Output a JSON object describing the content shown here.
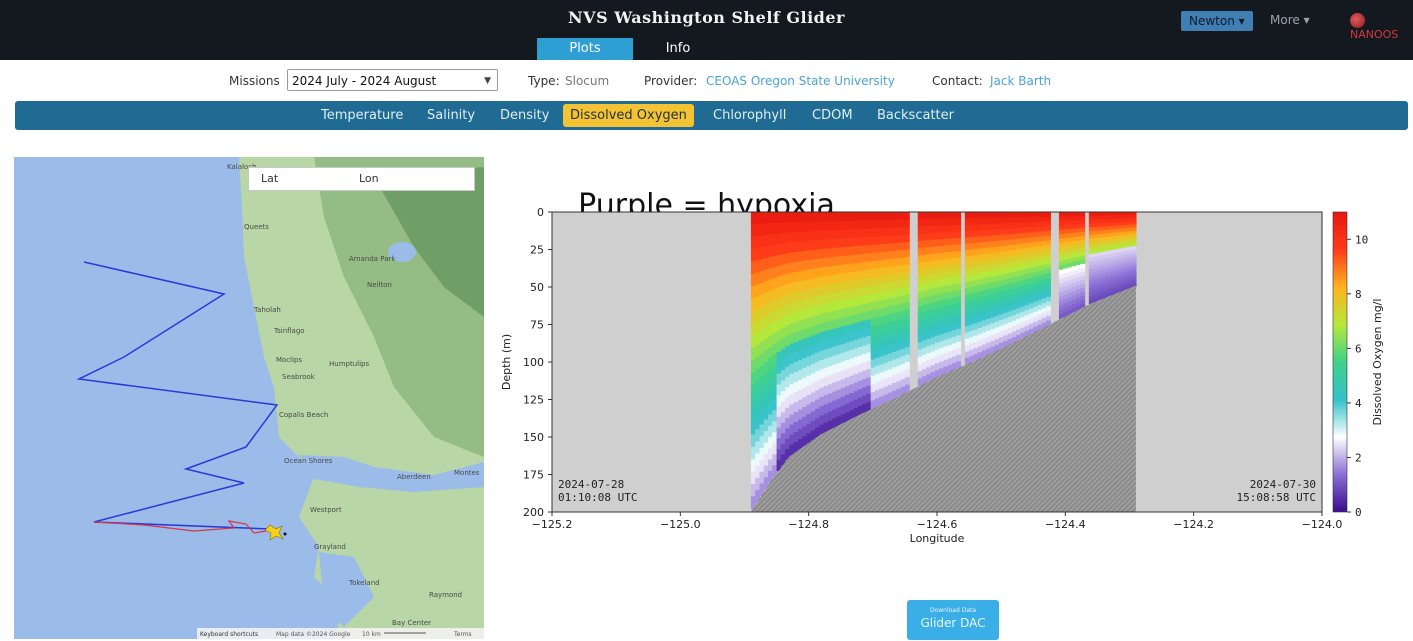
{
  "header": {
    "title": "NVS Washington Shelf Glider",
    "tabs": [
      "Plots",
      "Info"
    ],
    "user_button": "Newton ▾",
    "more": "More ▾",
    "logo_text": "NANOOS"
  },
  "info": {
    "missions_label": "Missions",
    "mission_selected": "2024 July - 2024 August",
    "type_label": "Type:",
    "type_value": "Slocum",
    "provider_label": "Provider:",
    "provider_value": "CEOAS Oregon State University",
    "contact_label": "Contact:",
    "contact_value": "Jack Barth"
  },
  "variables": [
    "Temperature",
    "Salinity",
    "Density",
    "Dissolved Oxygen",
    "Chlorophyll",
    "CDOM",
    "Backscatter"
  ],
  "active_variable": "Dissolved Oxygen",
  "map": {
    "latlon_labels": [
      "Lat",
      "Lon"
    ],
    "places": [
      "Kalaloch",
      "Queets",
      "Amanda Park",
      "Neilton",
      "Taholah",
      "Tsinflago",
      "Moclips",
      "Humptulips",
      "Seabrook",
      "Copalis Beach",
      "Ocean Shores",
      "Aberdeen",
      "Montes",
      "Westport",
      "Grayland",
      "Tokeland",
      "Raymond",
      "Bay Center"
    ],
    "footer": [
      "Keyboard shortcuts",
      "Map data ©2024 Google",
      "10 km",
      "Terms"
    ]
  },
  "annotation": "Purple = hypoxia",
  "chart_data": {
    "type": "heatmap",
    "title": "",
    "xlabel": "Longitude",
    "ylabel": "Depth (m)",
    "xlim": [
      -125.2,
      -124.0
    ],
    "ylim": [
      200,
      0
    ],
    "x_ticks": [
      "−125.2",
      "−125.0",
      "−124.8",
      "−124.6",
      "−124.4",
      "−124.2",
      "−124.0"
    ],
    "y_ticks": [
      "0",
      "25",
      "50",
      "75",
      "100",
      "125",
      "150",
      "175",
      "200"
    ],
    "colorbar": {
      "label": "Dissolved Oxygen mg/l",
      "ticks": [
        "0",
        "2",
        "4",
        "6",
        "8",
        "10"
      ],
      "range": [
        0,
        11
      ],
      "colors": [
        "#3a0b8e",
        "#8a6fd6",
        "#ffffff",
        "#33c1c9",
        "#3fd28a",
        "#b7e83a",
        "#ffb21e",
        "#ff3b1a",
        "#e8170e"
      ]
    },
    "start_label": [
      "2024-07-28",
      "01:10:08 UTC"
    ],
    "end_label": [
      "2024-07-30",
      "15:08:58 UTC"
    ],
    "data_lon_range": [
      -124.89,
      -124.29
    ],
    "seafloor_depth": [
      {
        "lon": -124.89,
        "depth": 200
      },
      {
        "lon": -124.86,
        "depth": 180
      },
      {
        "lon": -124.83,
        "depth": 163
      },
      {
        "lon": -124.78,
        "depth": 148
      },
      {
        "lon": -124.72,
        "depth": 135
      },
      {
        "lon": -124.66,
        "depth": 123
      },
      {
        "lon": -124.6,
        "depth": 110
      },
      {
        "lon": -124.54,
        "depth": 99
      },
      {
        "lon": -124.48,
        "depth": 87
      },
      {
        "lon": -124.42,
        "depth": 74
      },
      {
        "lon": -124.36,
        "depth": 61
      },
      {
        "lon": -124.29,
        "depth": 49
      }
    ],
    "data_gaps": [
      [
        -124.645,
        -124.63
      ],
      [
        -124.565,
        -124.555
      ],
      [
        -124.42,
        -124.41
      ],
      [
        -124.37,
        -124.362
      ]
    ]
  },
  "download_button": [
    "Download Data",
    "Glider DAC"
  ]
}
